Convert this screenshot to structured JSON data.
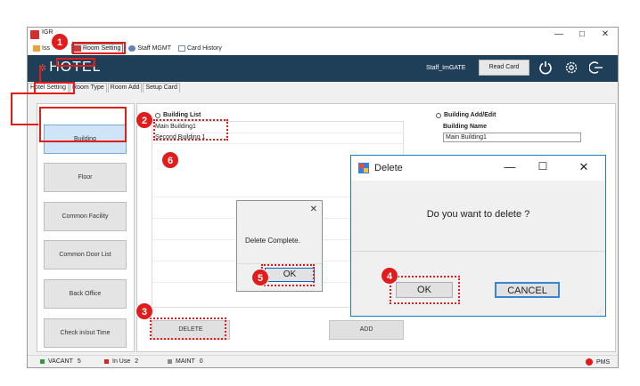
{
  "window": {
    "title": "IGR",
    "min_glyph": "—",
    "max_glyph": "☐",
    "close_glyph": "✕"
  },
  "menu": [
    {
      "label": "Iss",
      "icon": "issue-icon"
    },
    {
      "label": "Room Setting",
      "icon": "room-setting-icon"
    },
    {
      "label": "Staff MGMT",
      "icon": "staff-icon"
    },
    {
      "label": "Card History",
      "icon": "card-history-icon"
    }
  ],
  "header": {
    "logo_mark": "✲",
    "logo": "HOTEL",
    "user": "Staff_ImGATE",
    "read_card": "Read Card",
    "icons": [
      "power-icon",
      "settings-gear-icon",
      "logout-icon"
    ]
  },
  "tabs": [
    "Hotel Setting",
    "Room Type",
    "Room Add",
    "Setup Card"
  ],
  "sidebar": [
    "Building",
    "Floor",
    "Common Facility",
    "Common Door List",
    "Back Office",
    "Check in/out Time"
  ],
  "building_list": {
    "title": "Building List",
    "items": [
      "Main Building1",
      "Second Building 1"
    ]
  },
  "building_edit": {
    "title": "Building Add/Edit",
    "name_label": "Building Name",
    "name_value": "Main Building1"
  },
  "actions": {
    "delete": "DELETE",
    "add": "ADD"
  },
  "status": {
    "vacant_label": "VACANT",
    "vacant_count": "5",
    "inuse_label": "In Use",
    "inuse_count": "2",
    "maint_label": "MAINT",
    "maint_count": "0",
    "pms": "PMS",
    "colors": {
      "vacant": "#2e9b3a",
      "inuse": "#d42323",
      "maint": "#8a8a8a",
      "pms": "#e01818"
    }
  },
  "message_box": {
    "text": "Delete Complete.",
    "ok": "OK",
    "close": "✕"
  },
  "confirm_dialog": {
    "title": "Delete",
    "question": "Do you want to delete ?",
    "ok": "OK",
    "cancel": "CANCEL",
    "min": "—",
    "max": "☐",
    "close": "✕"
  },
  "annotations": {
    "badges": [
      "1",
      "2",
      "3",
      "4",
      "5",
      "6"
    ],
    "color": "#e21b1b"
  }
}
